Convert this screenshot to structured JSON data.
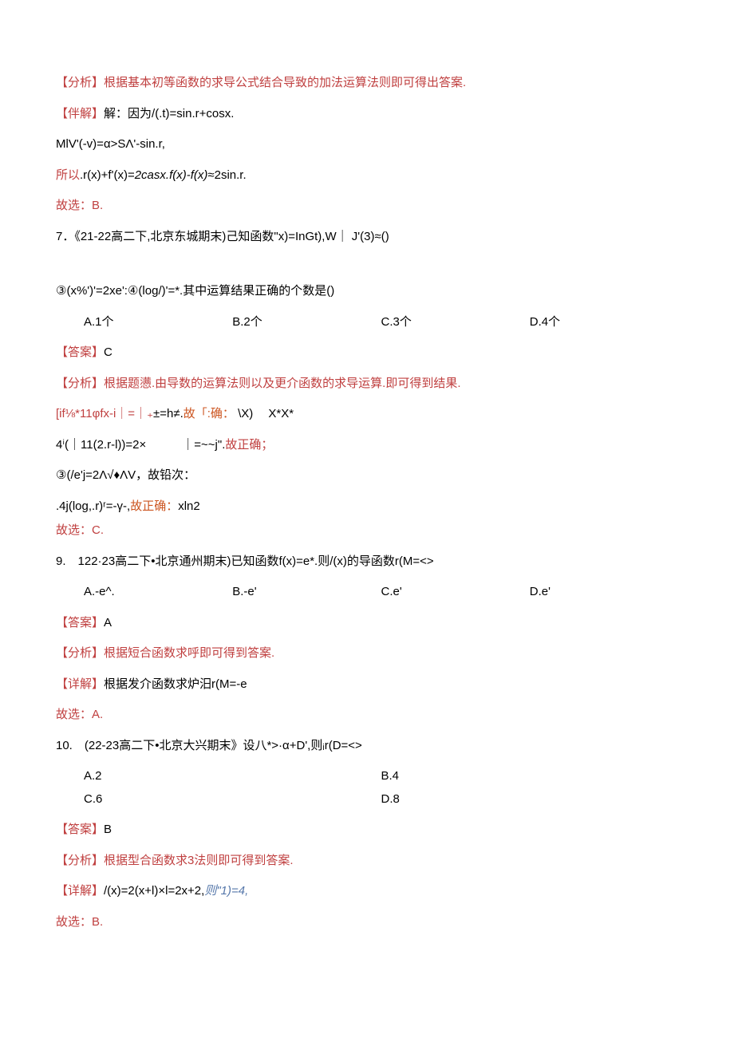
{
  "line1": {
    "label": "【分析】",
    "text": "根据基本初等函数的求导公式结合导致的加法运算法则即可得出答案."
  },
  "line2": {
    "label": "【伴解】",
    "text": "解：因为",
    "expr": "/(.t)=sin.r+cosx."
  },
  "line3": "MlV'(-v)=α>SΛ'-sin.r,",
  "line4": {
    "prefix": "所以",
    "text": ".r(x)+f'(x)=",
    "italic": "2casx.f(x)-f(x)",
    "suffix": "≈2sin.r."
  },
  "line5": {
    "prefix": "故选：",
    "answer": "B."
  },
  "q7": "7．《21-22高二下,北京东城期末)己知函数\"x)=InGt),W｜ J'(3)≈()",
  "line7": "③(x%')'=2xe':④(log/)'=*.其中运算结果正确的个数是()",
  "options8": {
    "a": "A.1个",
    "b": "B.2个",
    "c": "C.3个",
    "d": "D.4个"
  },
  "ans8": {
    "label": "【答案】",
    "val": "C"
  },
  "line9": {
    "label": "【分析】",
    "text": "根据题懑.由导数的运算法则以及更介函数的求导运算.即可得到结果."
  },
  "line10": {
    "red": "[if⅛*11φfx-i｜=｜₊",
    "black": "±=h≠.",
    "orange": "故「:确：",
    "rest": " \\X)　 X*X*"
  },
  "line11": {
    "black": "4ⁱ(｜11(2.r-l))=2×　　　｜=~~j\".",
    "red": "故正确；"
  },
  "line12": "③(/e'j=2Λ√♦ΛV，故铅次：",
  "line13": {
    "black": ".4j(log,.r)ʳ=-γ-,",
    "orange": "故正确：",
    "rest": "xln2"
  },
  "line14": {
    "prefix": "故选：",
    "answer": "C."
  },
  "q9": "9.　122·23高二下•北京通州期末)已知函数f(x)=e*.则/(x)的导函数r(M=<>",
  "options9": {
    "a": "A.-e^.",
    "b": "B.-e'",
    "c": "C.e'",
    "d": "D.e'"
  },
  "ans9a": {
    "label": "【答案】",
    "val": "A"
  },
  "line9b": {
    "label": "【分析】",
    "text": "根据短合函数求呼即可得到答案."
  },
  "line9c": {
    "label": "【详解】",
    "text": "根据发介函数求炉汨r(M=-e"
  },
  "line9d": {
    "prefix": "故选：",
    "answer": "A."
  },
  "q10": "10.　(22-23高二下•北京大兴期末》设八*>·α+D',则ᵢr(D=<>",
  "options10": {
    "a": "A.2",
    "b": "B.4",
    "c": "C.6",
    "d": "D.8"
  },
  "ans10a": {
    "label": "【答案】",
    "val": "B"
  },
  "line10b": {
    "label": "【分析】",
    "text": "根据型合函数求3法则即可得到答案."
  },
  "line10c": {
    "label": "【详解】",
    "text": "/(x)=2(x+l)×l=2x+2,",
    "italic": "则\"1)=4,"
  },
  "line10d": {
    "prefix": "故选：",
    "answer": "B."
  }
}
